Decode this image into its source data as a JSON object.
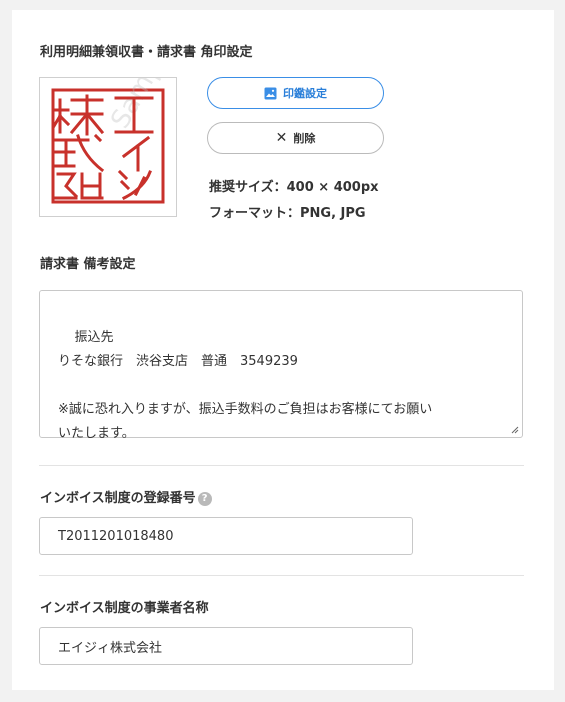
{
  "seal_section": {
    "title": "利用明細兼領収書・請求書 角印設定",
    "seal_watermark": "Sample",
    "set_button_label": "印鑑設定",
    "delete_button_label": "削除",
    "recommended_size": "推奨サイズ：400 × 400px",
    "formats": "フォーマット：PNG, JPG",
    "seal_color": "#c8312b",
    "accent_color": "#3a8ee6"
  },
  "remarks_section": {
    "title": "請求書 備考設定",
    "value": "振込先\nりそな銀行　渋谷支店　普通　3549239\n\n※誠に恐れ入りますが、振込手数料のご負担はお客様にてお願い\nいたします。"
  },
  "invoice_number_section": {
    "title": "インボイス制度の登録番号",
    "help_icon": "?",
    "value": "T2011201018480"
  },
  "invoice_name_section": {
    "title": "インボイス制度の事業者名称",
    "value": "エイジィ株式会社"
  }
}
